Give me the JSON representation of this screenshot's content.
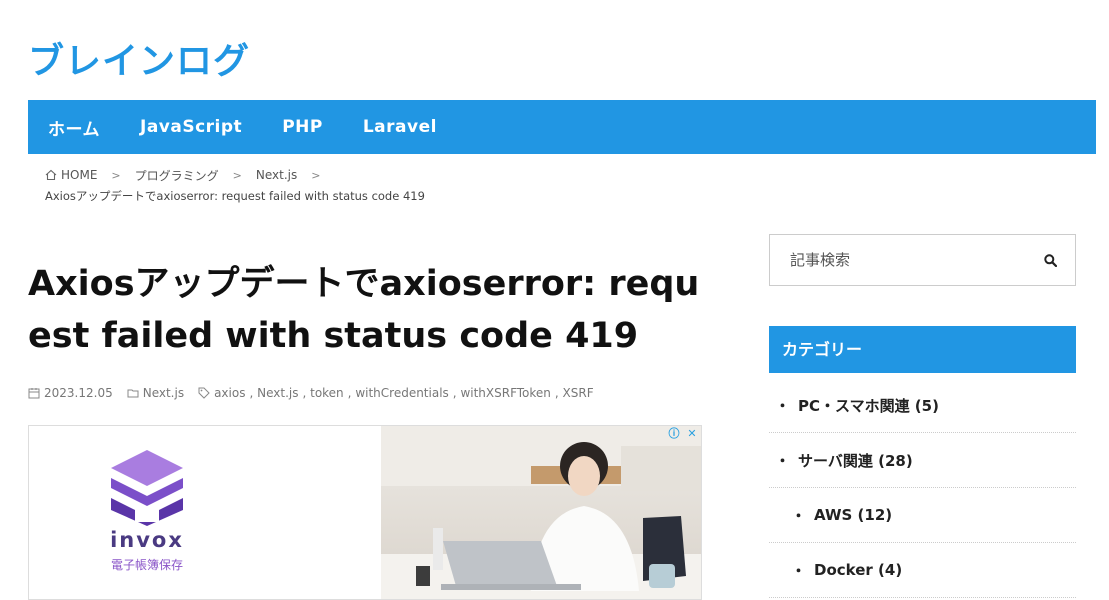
{
  "site": {
    "title": "ブレインログ",
    "accent": "#2196e3"
  },
  "nav": {
    "items": [
      "ホーム",
      "JavaScript",
      "PHP",
      "Laravel"
    ]
  },
  "breadcrumb": {
    "home": "HOME",
    "items": [
      "プログラミング",
      "Next.js"
    ],
    "current": "Axiosアップデートでaxioserror: request failed with status code 419"
  },
  "article": {
    "title": "Axiosアップデートでaxioserror: request failed with status code 419",
    "date": "2023.12.05",
    "category": "Next.js",
    "tags": [
      "axios",
      "Next.js",
      "token",
      "withCredentials",
      "withXSRFToken",
      "XSRF"
    ]
  },
  "ad": {
    "brand": "invox",
    "subtitle": "電子帳簿保存",
    "choice_info": "ⓘ",
    "choice_close": "✕"
  },
  "sidebar": {
    "search_placeholder": "記事検索",
    "category_heading": "カテゴリー",
    "categories": [
      {
        "label": "PC・スマホ関連 (5)",
        "level": 0
      },
      {
        "label": "サーバ関連 (28)",
        "level": 0
      },
      {
        "label": "AWS (12)",
        "level": 1
      },
      {
        "label": "Docker (4)",
        "level": 1
      }
    ]
  }
}
